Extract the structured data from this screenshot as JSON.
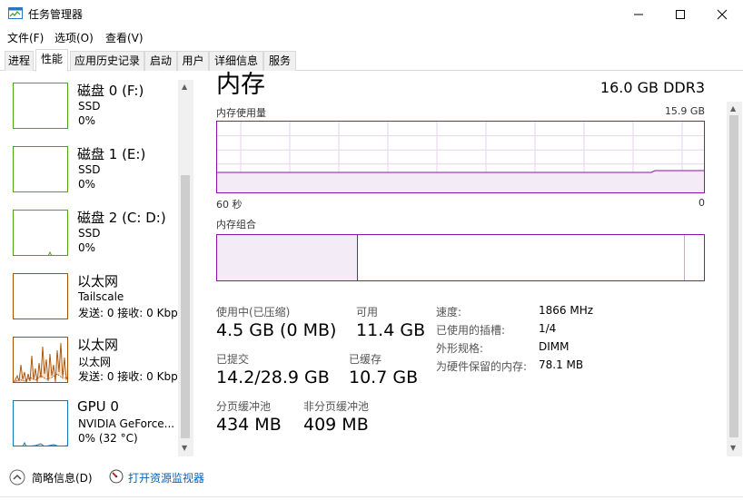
{
  "window": {
    "title": "任务管理器"
  },
  "menu": [
    "文件(F)",
    "选项(O)",
    "查看(V)"
  ],
  "tabs": [
    "进程",
    "性能",
    "应用历史记录",
    "启动",
    "用户",
    "详细信息",
    "服务"
  ],
  "sidebar": {
    "items": [
      {
        "name": "磁盘 0 (F:)",
        "sub": "SSD",
        "value": "0%"
      },
      {
        "name": "磁盘 1 (E:)",
        "sub": "SSD",
        "value": "0%"
      },
      {
        "name": "磁盘 2 (C: D:)",
        "sub": "SSD",
        "value": "0%"
      },
      {
        "name": "以太网",
        "sub": "Tailscale",
        "value": "发送: 0 接收: 0 Kbps"
      },
      {
        "name": "以太网",
        "sub": "以太网",
        "value": "发送: 0 接收: 0 Kbps"
      },
      {
        "name": "GPU 0",
        "sub": "NVIDIA GeForce...",
        "value": "0% (32 °C)"
      }
    ]
  },
  "main": {
    "title": "内存",
    "spec": "16.0 GB DDR3",
    "graph_label": "内存使用量",
    "graph_max": "15.9 GB",
    "graph_left": "60 秒",
    "graph_right": "0",
    "composition_label": "内存组合",
    "stats": {
      "in_use_label": "使用中(已压缩)",
      "in_use_value": "4.5 GB (0 MB)",
      "available_label": "可用",
      "available_value": "11.4 GB",
      "committed_label": "已提交",
      "committed_value": "14.2/28.9 GB",
      "cached_label": "已缓存",
      "cached_value": "10.7 GB",
      "paged_label": "分页缓冲池",
      "paged_value": "434 MB",
      "nonpaged_label": "非分页缓冲池",
      "nonpaged_value": "409 MB"
    },
    "details": {
      "speed_label": "速度:",
      "speed_value": "1866 MHz",
      "slots_label": "已使用的插槽:",
      "slots_value": "1/4",
      "form_label": "外形规格:",
      "form_value": "DIMM",
      "reserved_label": "为硬件保留的内存:",
      "reserved_value": "78.1 MB"
    }
  },
  "footer": {
    "summary": "简略信息(D)",
    "monitor": "打开资源监视器"
  },
  "colors": {
    "memory_accent": "#8b12ae",
    "disk_accent": "#4da60c",
    "ethernet_accent": "#a74f01",
    "gpu_accent": "#1177bb"
  }
}
